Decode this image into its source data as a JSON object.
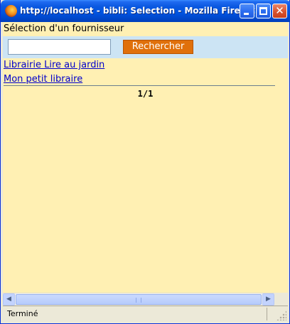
{
  "window": {
    "title": "http://localhost - bibli: Selection - Mozilla Firefox",
    "icon": "firefox-icon",
    "controls": [
      "minimize-icon",
      "maximize-icon",
      "close-icon"
    ]
  },
  "page": {
    "heading": "Sélection d'un fournisseur",
    "search": {
      "value": "",
      "placeholder": "",
      "button_label": "Rechercher"
    },
    "results": [
      {
        "label": "Librairie Lire au jardin"
      },
      {
        "label": "Mon petit libraire"
      }
    ],
    "pager": "1/1"
  },
  "scrollbar": {
    "left_arrow": "◀",
    "right_arrow": "▶"
  },
  "statusbar": {
    "text": "Terminé"
  },
  "colors": {
    "page_background": "#fff0b3",
    "search_bar_background": "#cce4f4",
    "button_background": "#e0700a",
    "link": "#0000cc"
  }
}
